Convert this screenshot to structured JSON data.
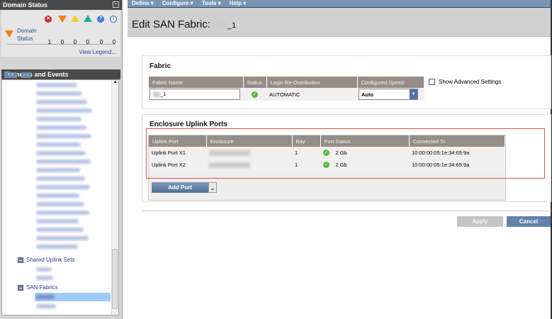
{
  "domain_status": {
    "title": "Domain Status",
    "label": "Domain Status",
    "label_line1": "Domain",
    "label_line2": "Status",
    "counts": [
      "1",
      "0",
      "0",
      "0",
      "0",
      "0"
    ],
    "view_legend": "View Legend...",
    "minimize": "−"
  },
  "elements": {
    "title": "Elements and Events",
    "expand_all": "+ +",
    "collapse_all": "– –",
    "shared_uplink_sets": "Shared Uplink Sets",
    "san_fabrics": "SAN Fabrics"
  },
  "menu": [
    "Define ▾",
    "Configure ▾",
    "Tools ▾",
    "Help ▾"
  ],
  "page": {
    "title": "Edit SAN Fabric:",
    "title_suffix": "_1"
  },
  "fabric": {
    "title": "Fabric",
    "headers": [
      "Fabric Name",
      "Status",
      "Login Re-Distribution",
      "Configured Speed"
    ],
    "name_value": "_1",
    "login_redistribution": "AUTOMATIC",
    "speed": "Auto",
    "show_advanced": "Show Advanced Settings"
  },
  "uplinks": {
    "title": "Enclosure Uplink Ports",
    "headers": [
      "Uplink Port",
      "Enclosure",
      "Bay",
      "Port Status",
      "Connected To"
    ],
    "rows": [
      {
        "port": "Uplink Port X1",
        "bay": "1",
        "status": "2 Gb",
        "connected": "10:00:00:05:1e:34:65:9a"
      },
      {
        "port": "Uplink Port X2",
        "bay": "1",
        "status": "2 Gb",
        "connected": "10:00:00:05:1e:34:65:9a"
      }
    ],
    "add_port": "Add Port",
    "highlight_color": "#e05050"
  },
  "actions": {
    "apply": "Apply",
    "cancel": "Cancel"
  }
}
